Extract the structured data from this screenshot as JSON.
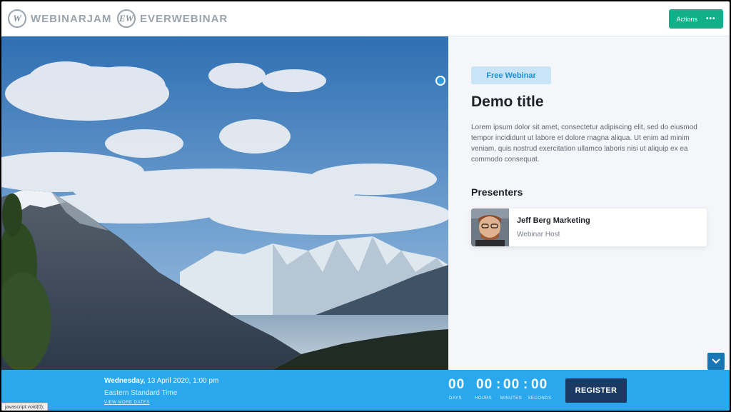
{
  "header": {
    "brand1": {
      "mark": "W",
      "text": "WEBINARJAM"
    },
    "brand2": {
      "mark": "EW",
      "text": "EVERWEBINAR"
    },
    "actions_label": "Actions",
    "actions_icon": "more-dots-icon",
    "actions_dots": "•••"
  },
  "panel": {
    "badge": "Free Webinar",
    "title": "Demo title",
    "description": "Lorem ipsum dolor sit amet, consectetur adipiscing elit, sed do eiusmod tempor incididunt ut labore et dolore magna aliqua. Ut enim ad minim veniam, quis nostrud exercitation ullamco laboris nisi ut aliquip ex ea commodo consequat.",
    "presenters_heading": "Presenters",
    "presenter": {
      "name": "Jeff Berg Marketing",
      "role": "Webinar Host"
    }
  },
  "bar": {
    "weekday": "Wednesday,",
    "date_time": " 13 April 2020, 1:00 pm",
    "timezone": "Eastern Standard Time",
    "more_dates": "VIEW MORE DATES",
    "countdown": {
      "days": "00",
      "hours": "00",
      "minutes": "00",
      "seconds": "00",
      "sep": ":",
      "days_label": "DAYS",
      "hours_label": "HOURS",
      "minutes_label": "MINUTES",
      "seconds_label": "SECONDS"
    },
    "register_label": "REGISTER"
  },
  "status_bar": "javascript:void(0);",
  "colors": {
    "accent_green": "#12b089",
    "bar_blue": "#2aa8ee",
    "register_navy": "#1a3a63",
    "badge_bg": "#c9e4f7"
  }
}
